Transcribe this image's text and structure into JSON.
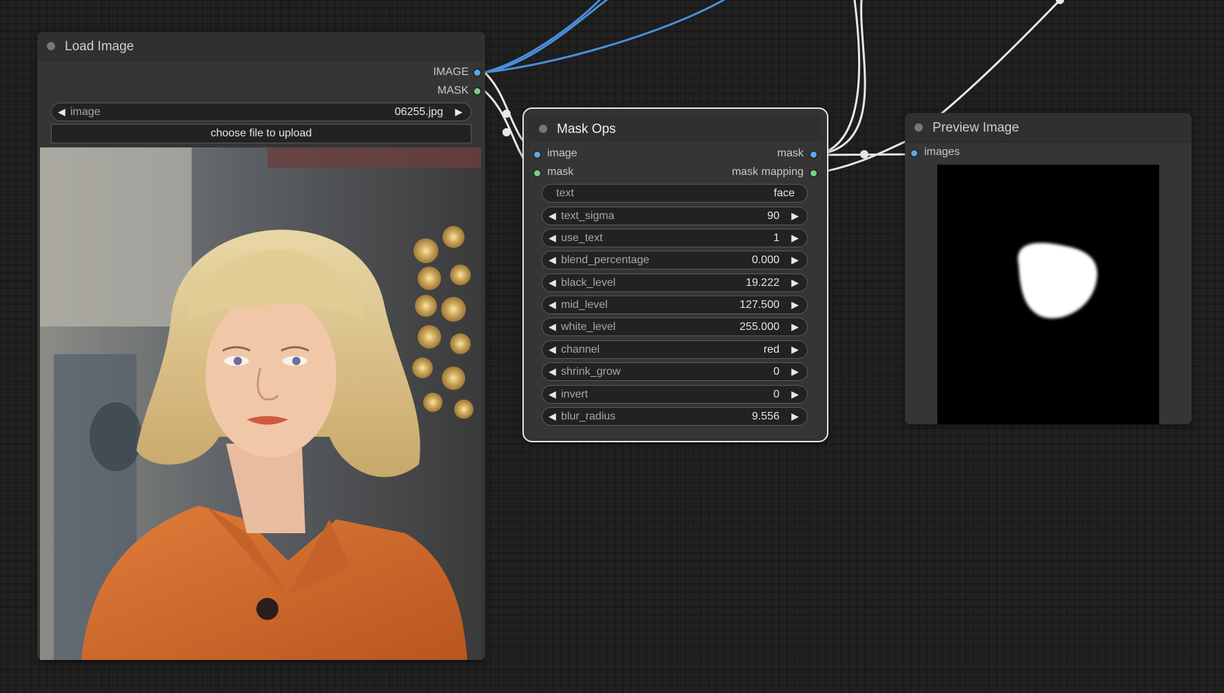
{
  "nodes": {
    "load_image": {
      "title": "Load Image",
      "outputs": [
        "IMAGE",
        "MASK"
      ],
      "image_widget": {
        "label": "image",
        "value": "06255.jpg"
      },
      "upload_label": "choose file to upload",
      "photo_icon": "portrait-photo"
    },
    "mask_ops": {
      "title": "Mask Ops",
      "inputs": [
        "image",
        "mask"
      ],
      "outputs": [
        "mask",
        "mask mapping"
      ],
      "text_widget": {
        "label": "text",
        "value": "face"
      },
      "widgets": [
        {
          "label": "text_sigma",
          "value": "90"
        },
        {
          "label": "use_text",
          "value": "1"
        },
        {
          "label": "blend_percentage",
          "value": "0.000"
        },
        {
          "label": "black_level",
          "value": "19.222"
        },
        {
          "label": "mid_level",
          "value": "127.500"
        },
        {
          "label": "white_level",
          "value": "255.000"
        },
        {
          "label": "channel",
          "value": "red"
        },
        {
          "label": "shrink_grow",
          "value": "0"
        },
        {
          "label": "invert",
          "value": "0"
        },
        {
          "label": "blur_radius",
          "value": "9.556"
        }
      ]
    },
    "preview_image": {
      "title": "Preview Image",
      "inputs": [
        "images"
      ],
      "image_icon": "mask-preview"
    }
  },
  "colors": {
    "image_slot": "#5aa8e8",
    "mask_slot": "#7ccf7c",
    "image_link": "#4a90d9",
    "mask_link": "#e8e8e8",
    "canvas": "#202020",
    "node_body": "#353535"
  }
}
